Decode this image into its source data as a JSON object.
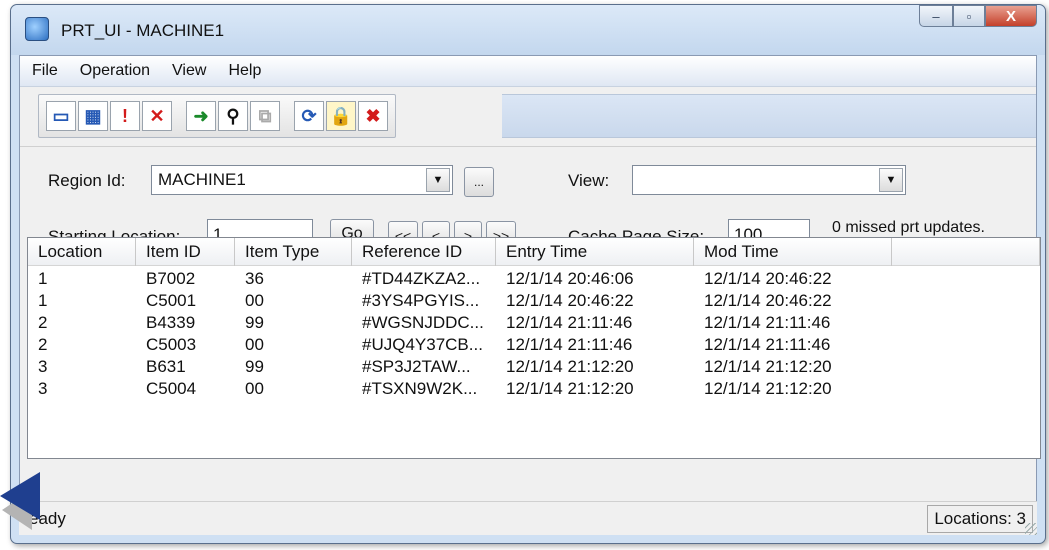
{
  "window": {
    "title": "PRT_UI - MACHINE1",
    "controls": {
      "minimize": "‒",
      "maximize": "▫",
      "close": "X"
    }
  },
  "menu": [
    "File",
    "Operation",
    "View",
    "Help"
  ],
  "toolbar": [
    {
      "name": "new-icon",
      "glyph": "▭"
    },
    {
      "name": "calendar-icon",
      "glyph": "▦"
    },
    {
      "name": "alert-doc-icon",
      "glyph": "!"
    },
    {
      "name": "delete-icon",
      "glyph": "✕"
    },
    {
      "name": "go-arrow-icon",
      "glyph": "➜"
    },
    {
      "name": "find-icon",
      "glyph": "⚲"
    },
    {
      "name": "disabled-action-icon",
      "glyph": "⧉"
    },
    {
      "name": "refresh-icon",
      "glyph": "⟳"
    },
    {
      "name": "lock-icon",
      "glyph": "🔒"
    },
    {
      "name": "clear-icon",
      "glyph": "✖"
    }
  ],
  "form": {
    "region_label": "Region Id:",
    "region_value": "MACHINE1",
    "browse_label": "...",
    "view_label": "View:",
    "view_value": "",
    "start_label": "Starting Location:",
    "start_value": "1",
    "go_label": "Go",
    "nav": [
      "<<",
      "<",
      ">",
      ">>"
    ],
    "cache_label": "Cache Page Size:",
    "cache_value": "100",
    "missed_text": "0 missed prt updates."
  },
  "grid": {
    "columns": [
      "Location",
      "Item ID",
      "Item Type",
      "Reference ID",
      "Entry Time",
      "Mod Time",
      ""
    ],
    "rows": [
      [
        "1",
        "B7002",
        "36",
        "#TD44ZKZA2...",
        "12/1/14 20:46:06",
        "12/1/14 20:46:22"
      ],
      [
        "1",
        "C5001",
        "00",
        "#3YS4PGYIS...",
        "12/1/14 20:46:22",
        "12/1/14 20:46:22"
      ],
      [
        "2",
        "B4339",
        "99",
        "#WGSNJDDC...",
        "12/1/14 21:11:46",
        "12/1/14 21:11:46"
      ],
      [
        "2",
        "C5003",
        "00",
        "#UJQ4Y37CB...",
        "12/1/14 21:11:46",
        "12/1/14 21:11:46"
      ],
      [
        "3",
        "B631",
        "99",
        "#SP3J2TAW...",
        "12/1/14 21:12:20",
        "12/1/14 21:12:20"
      ],
      [
        "3",
        "C5004",
        "00",
        "#TSXN9W2K...",
        "12/1/14 21:12:20",
        "12/1/14 21:12:20"
      ]
    ]
  },
  "status": {
    "left": "eady",
    "right": "Locations: 3"
  }
}
